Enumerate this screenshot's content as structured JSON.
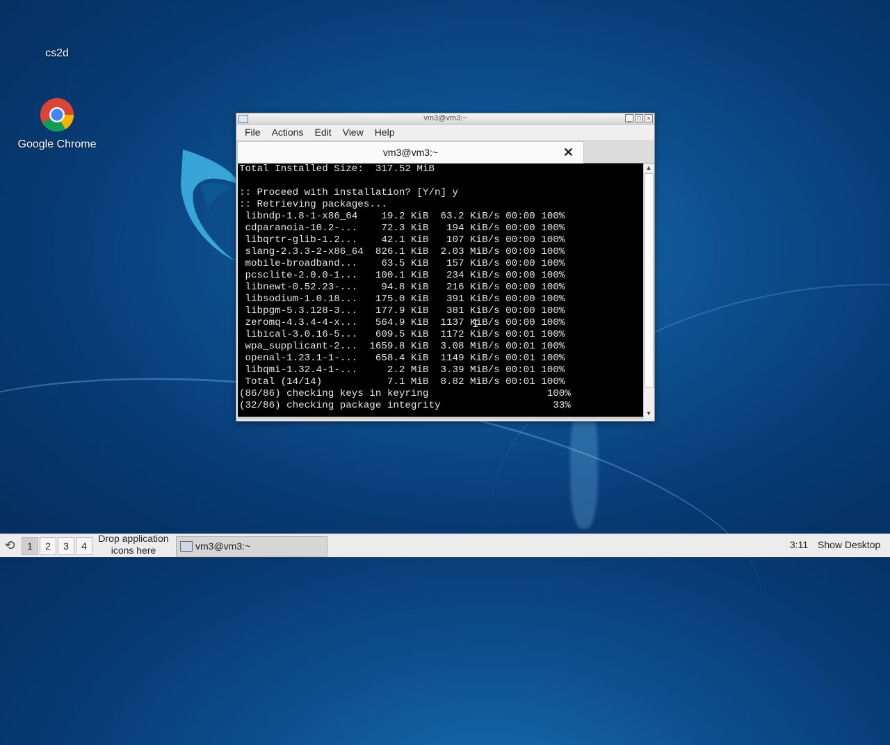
{
  "desktop": {
    "icons": [
      {
        "label": "cs2d"
      },
      {
        "label": "Google Chrome",
        "icon": "chrome-icon"
      }
    ]
  },
  "window": {
    "title": "vm3@vm3:~",
    "menu": [
      "File",
      "Actions",
      "Edit",
      "View",
      "Help"
    ],
    "tab_label": "vm3@vm3:~",
    "tab_close": "✕",
    "terminal_lines": [
      "Total Installed Size:  317.52 MiB",
      "",
      ":: Proceed with installation? [Y/n] y",
      ":: Retrieving packages...",
      " libndp-1.8-1-x86_64    19.2 KiB  63.2 KiB/s 00:00 100%",
      " cdparanoia-10.2-...    72.3 KiB   194 KiB/s 00:00 100%",
      " libqrtr-glib-1.2...    42.1 KiB   107 KiB/s 00:00 100%",
      " slang-2.3.3-2-x86_64  826.1 KiB  2.03 MiB/s 00:00 100%",
      " mobile-broadband...    63.5 KiB   157 KiB/s 00:00 100%",
      " pcsclite-2.0.0-1...   100.1 KiB   234 KiB/s 00:00 100%",
      " libnewt-0.52.23-...    94.8 KiB   216 KiB/s 00:00 100%",
      " libsodium-1.0.18...   175.0 KiB   391 KiB/s 00:00 100%",
      " libpgm-5.3.128-3...   177.9 KiB   381 KiB/s 00:00 100%",
      " zeromq-4.3.4-4-x...   564.9 KiB  1137 KiB/s 00:00 100%",
      " libical-3.0.16-5...   609.5 KiB  1172 KiB/s 00:01 100%",
      " wpa_supplicant-2...  1659.8 KiB  3.08 MiB/s 00:01 100%",
      " openal-1.23.1-1-...   658.4 KiB  1149 KiB/s 00:01 100%",
      " libqmi-1.32.4-1-...     2.2 MiB  3.39 MiB/s 00:01 100%",
      " Total (14/14)           7.1 MiB  8.82 MiB/s 00:01 100%",
      "(86/86) checking keys in keyring                    100%",
      "(32/86) checking package integrity                   33%"
    ]
  },
  "taskbar": {
    "workspaces": [
      "1",
      "2",
      "3",
      "4"
    ],
    "active_workspace": "1",
    "drop_text": "Drop application icons here",
    "task_label": "vm3@vm3:~",
    "clock": "3:11",
    "show_desktop": "Show Desktop"
  }
}
